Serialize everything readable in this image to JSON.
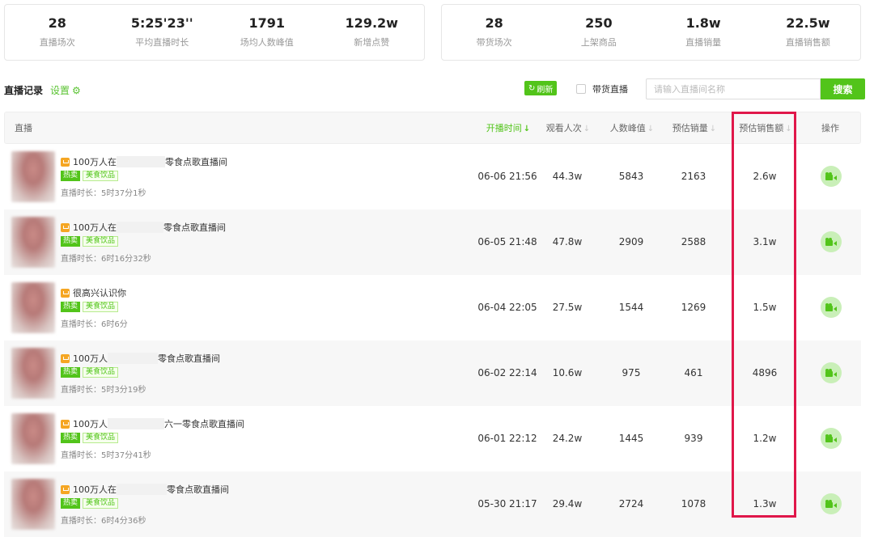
{
  "stats_left": [
    {
      "value": "28",
      "label": "直播场次"
    },
    {
      "value": "5:25'23''",
      "label": "平均直播时长"
    },
    {
      "value": "1791",
      "label": "场均人数峰值"
    },
    {
      "value": "129.2w",
      "label": "新增点赞"
    }
  ],
  "stats_right": [
    {
      "value": "28",
      "label": "带货场次"
    },
    {
      "value": "250",
      "label": "上架商品"
    },
    {
      "value": "1.8w",
      "label": "直播销量"
    },
    {
      "value": "22.5w",
      "label": "直播销售额"
    }
  ],
  "toolbar": {
    "title": "直播记录",
    "settings_label": "设置",
    "refresh_label": "刷新",
    "checkbox_label": "带货直播",
    "search_placeholder": "请输入直播间名称",
    "search_button": "搜索"
  },
  "columns": {
    "live": "直播",
    "start_time": "开播时间",
    "viewers": "观看人次",
    "peak": "人数峰值",
    "est_sales": "预估销量",
    "est_revenue": "预估销售额",
    "action": "操作"
  },
  "rows": [
    {
      "title_a": "100万人在",
      "title_b": "零食点歌直播间",
      "tag_hot": "热卖",
      "tag_cat": "美食饮品",
      "duration": "直播时长：5时37分1秒",
      "start": "06-06 21:56",
      "viewers": "44.3w",
      "peak": "5843",
      "sales": "2163",
      "revenue": "2.6w"
    },
    {
      "title_a": "100万人在",
      "title_b": "零食点歌直播间",
      "tag_hot": "热卖",
      "tag_cat": "美食饮品",
      "duration": "直播时长：6时16分32秒",
      "start": "06-05 21:48",
      "viewers": "47.8w",
      "peak": "2909",
      "sales": "2588",
      "revenue": "3.1w"
    },
    {
      "title_a": "很高兴认识你",
      "title_b": "",
      "tag_hot": "热卖",
      "tag_cat": "美食饮品",
      "duration": "直播时长：6时6分",
      "start": "06-04 22:05",
      "viewers": "27.5w",
      "peak": "1544",
      "sales": "1269",
      "revenue": "1.5w"
    },
    {
      "title_a": "100万人",
      "title_b": "零食点歌直播间",
      "tag_hot": "热卖",
      "tag_cat": "美食饮品",
      "duration": "直播时长：5时3分19秒",
      "start": "06-02 22:14",
      "viewers": "10.6w",
      "peak": "975",
      "sales": "461",
      "revenue": "4896"
    },
    {
      "title_a": "100万人",
      "title_b": "六一零食点歌直播间",
      "tag_hot": "热卖",
      "tag_cat": "美食饮品",
      "duration": "直播时长：5时37分41秒",
      "start": "06-01 22:12",
      "viewers": "24.2w",
      "peak": "1445",
      "sales": "939",
      "revenue": "1.2w"
    },
    {
      "title_a": "100万人在",
      "title_b": "零食点歌直播间",
      "tag_hot": "热卖",
      "tag_cat": "美食饮品",
      "duration": "直播时长：6时4分36秒",
      "start": "05-30 21:17",
      "viewers": "29.4w",
      "peak": "2724",
      "sales": "1078",
      "revenue": "1.3w"
    }
  ],
  "colors": {
    "accent": "#52c41a",
    "highlight": "#e0174a",
    "ticket_icon": "#f5a623"
  },
  "icons": {
    "settings": "gear-icon",
    "refresh": "refresh-icon",
    "action": "video-camera-icon",
    "title": "ticket-icon"
  }
}
